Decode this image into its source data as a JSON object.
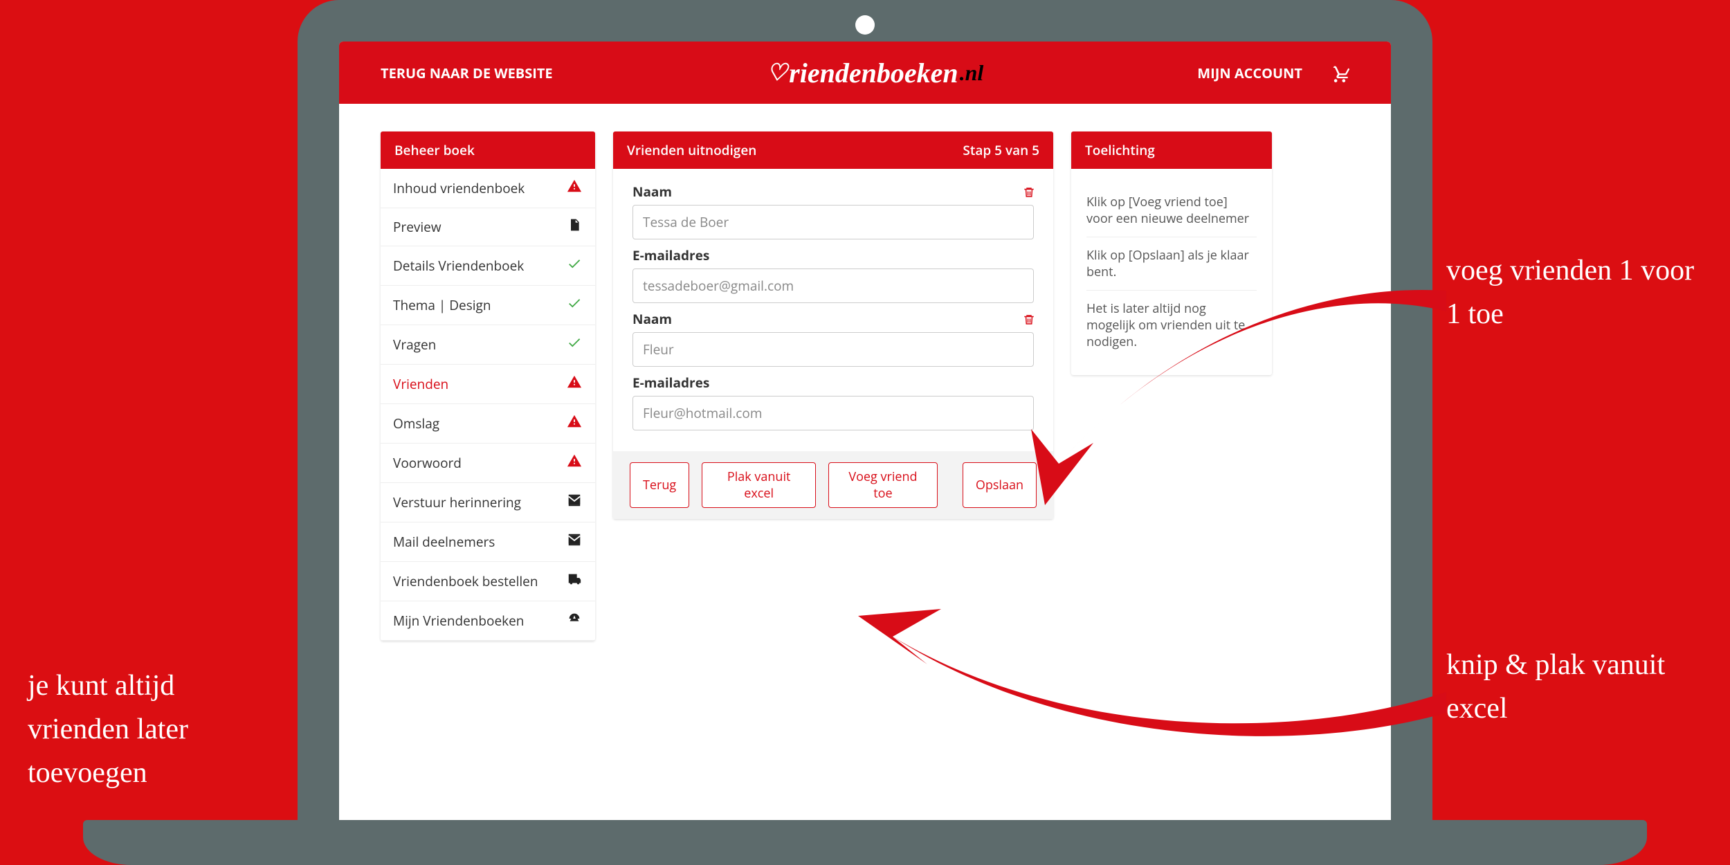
{
  "header": {
    "back": "TERUG NAAR DE WEBSITE",
    "account": "MIJN ACCOUNT",
    "brand_main": "riendenboeken",
    "brand_suffix": ".nl"
  },
  "sidebar": {
    "title": "Beheer boek",
    "items": [
      {
        "label": "Inhoud vriendenboek",
        "icon": "warn",
        "name": "sidebar-item-inhoud"
      },
      {
        "label": "Preview",
        "icon": "pdf",
        "name": "sidebar-item-preview"
      },
      {
        "label": "Details Vriendenboek",
        "icon": "ok",
        "name": "sidebar-item-details"
      },
      {
        "label": "Thema | Design",
        "icon": "ok",
        "name": "sidebar-item-thema"
      },
      {
        "label": "Vragen",
        "icon": "ok",
        "name": "sidebar-item-vragen"
      },
      {
        "label": "Vrienden",
        "icon": "warn",
        "name": "sidebar-item-vrienden",
        "active": true
      },
      {
        "label": "Omslag",
        "icon": "warn",
        "name": "sidebar-item-omslag"
      },
      {
        "label": "Voorwoord",
        "icon": "warn",
        "name": "sidebar-item-voorwoord"
      },
      {
        "label": "Verstuur herinnering",
        "icon": "mail",
        "name": "sidebar-item-herinnering"
      },
      {
        "label": "Mail deelnemers",
        "icon": "mail",
        "name": "sidebar-item-mail"
      },
      {
        "label": "Vriendenboek bestellen",
        "icon": "ship",
        "name": "sidebar-item-bestellen"
      },
      {
        "label": "Mijn Vriendenboeken",
        "icon": "dash",
        "name": "sidebar-item-mijn"
      }
    ]
  },
  "main": {
    "title": "Vrienden uitnodigen",
    "step": "Stap 5 van 5",
    "labels": {
      "name": "Naam",
      "email": "E-mailadres"
    },
    "friends": [
      {
        "name": "Tessa de Boer",
        "email": "tessadeboer@gmail.com"
      },
      {
        "name": "Fleur",
        "email": "Fleur@hotmail.com"
      }
    ],
    "buttons": {
      "back": "Terug",
      "paste": "Plak vanuit excel",
      "add": "Voeg vriend toe",
      "save": "Opslaan"
    }
  },
  "help": {
    "title": "Toelichting",
    "p1": "Klik op [Voeg vriend toe] voor een nieuwe deelnemer",
    "p2": "Klik op [Opslaan] als je klaar bent.",
    "p3": "Het is later altijd nog mogelijk om vrienden uit te nodigen."
  },
  "annotations": {
    "left": "je kunt altijd vrienden later toevoegen",
    "r1": "voeg vrienden 1 voor 1 toe",
    "r2": "knip & plak vanuit excel"
  }
}
